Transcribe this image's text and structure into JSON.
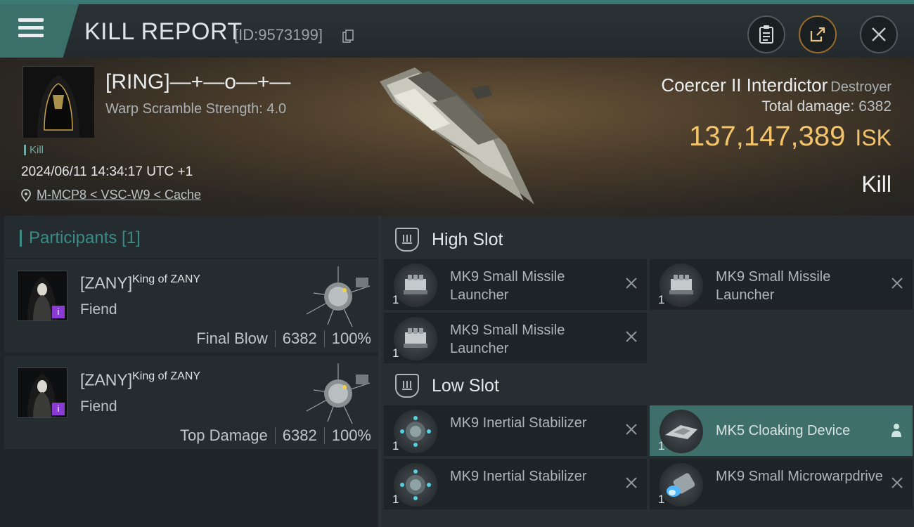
{
  "topbar": {
    "title": "KILL REPORT",
    "id_text": "[ID:9573199]"
  },
  "victim": {
    "name": "[RING]—+—o—+—",
    "warp_scramble": "Warp Scramble Strength: 4.0",
    "kill_tag": "Kill",
    "datetime": "2024/06/11 14:34:17 UTC +1",
    "location": "M-MCP8 < VSC-W9 < Cache",
    "ship_name": "Coercer II Interdictor",
    "ship_class": "Destroyer",
    "total_damage_label": "Total damage:",
    "total_damage": "6382",
    "isk_value": "137,147,389",
    "isk_unit": "ISK",
    "result": "Kill"
  },
  "participants": {
    "title": "Participants [1]",
    "items": [
      {
        "name": "[ZANY]",
        "title": "King of ZANY",
        "ship": "Fiend",
        "role": "Final Blow",
        "damage": "6382",
        "percent": "100%"
      },
      {
        "name": "[ZANY]",
        "title": "King of ZANY",
        "ship": "Fiend",
        "role": "Top Damage",
        "damage": "6382",
        "percent": "100%"
      }
    ]
  },
  "fittings": {
    "high_slot_label": "High Slot",
    "low_slot_label": "Low Slot",
    "high_modules": [
      {
        "name": "MK9 Small Missile Launcher",
        "qty": "1",
        "icon": "missile-launcher-icon"
      },
      {
        "name": "MK9 Small Missile Launcher",
        "qty": "1",
        "icon": "missile-launcher-icon"
      },
      {
        "name": "MK9 Small Missile Launcher",
        "qty": "1",
        "icon": "missile-launcher-icon"
      }
    ],
    "low_modules": [
      {
        "name": "MK9 Inertial Stabilizer",
        "qty": "1",
        "icon": "inertial-stabilizer-icon"
      },
      {
        "name": "MK5 Cloaking Device",
        "qty": "1",
        "icon": "cloaking-device-icon",
        "highlighted": true
      },
      {
        "name": "MK9 Inertial Stabilizer",
        "qty": "1",
        "icon": "inertial-stabilizer-icon"
      },
      {
        "name": "MK9 Small Microwarpdrive",
        "qty": "1",
        "icon": "microwarpdrive-icon"
      }
    ]
  },
  "colors": {
    "accent_teal": "#3b7a74",
    "isk_gold": "#f3c36b",
    "highlight_row": "#3e6f6a",
    "officer_badge": "#8a3bd4"
  }
}
